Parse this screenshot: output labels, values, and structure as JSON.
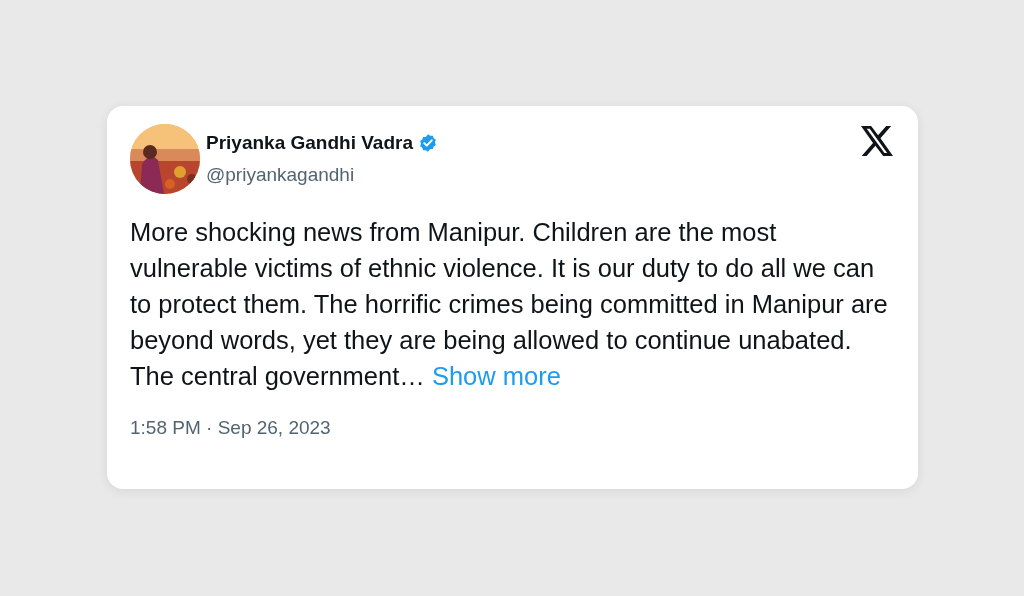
{
  "tweet": {
    "author": {
      "name": "Priyanka Gandhi Vadra",
      "verified": true,
      "handle": "@priyankagandhi"
    },
    "text": "More shocking news from Manipur. Children are the most vulnerable victims of ethnic violence. It is our duty to do all we can to protect them. The horrific crimes being committed in Manipur are beyond words, yet they are being allowed to continue unabated. The central government…",
    "show_more": "Show more",
    "timestamp": "1:58 PM · Sep 26, 2023"
  }
}
